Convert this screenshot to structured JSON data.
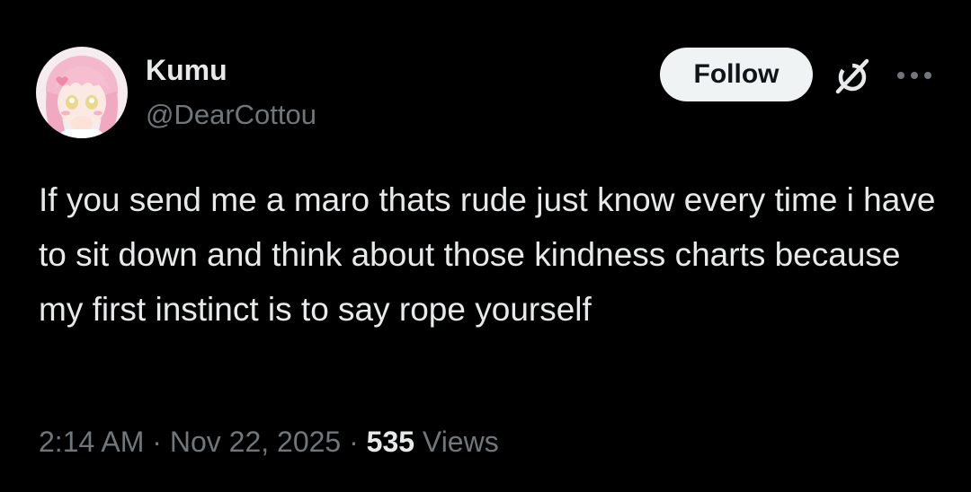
{
  "author": {
    "display_name": "Kumu",
    "handle": "@DearCottou",
    "avatar_icon": "anime-avatar-pink-hair"
  },
  "header": {
    "follow_label": "Follow",
    "grok_icon": "grok-icon",
    "more_icon": "more-icon"
  },
  "tweet": {
    "text": "If you send me a maro thats rude just know every time i have to sit down and think about those kindness charts because my first instinct is to say rope yourself"
  },
  "meta": {
    "time": "2:14 AM",
    "separator": "·",
    "date": "Nov 22, 2025",
    "views_count": "535",
    "views_label": "Views"
  },
  "colors": {
    "background": "#000000",
    "primary_text": "#e7e9ea",
    "secondary_text": "#71767b",
    "follow_bg": "#eff3f4",
    "follow_text": "#0f1419"
  }
}
